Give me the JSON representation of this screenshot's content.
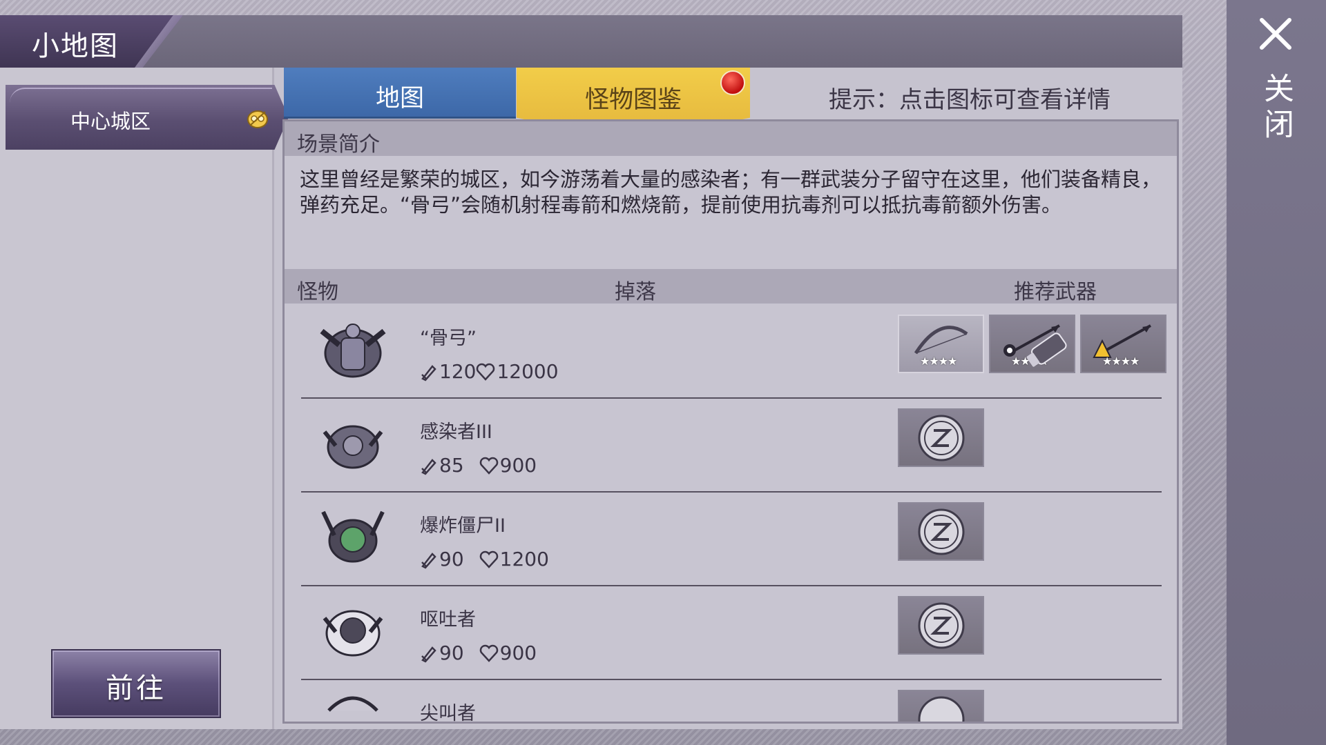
{
  "window": {
    "title": "小地图"
  },
  "sidebar": {
    "items": [
      {
        "label": "中心城区"
      }
    ],
    "go_label": "前往"
  },
  "tabs": {
    "map": "地图",
    "monsters": "怪物图鉴"
  },
  "hint": "提示：点击图标可查看详情",
  "scene": {
    "header": "场景简介",
    "description": "这里曾经是繁荣的城区，如今游荡着大量的感染者；有一群武装分子留守在这里，他们装备精良，弹药充足。“骨弓”会随机射程毒箭和燃烧箭，提前使用抗毒剂可以抵抗毒箭额外伤害。"
  },
  "table": {
    "col_monster": "怪物",
    "col_drop": "掉落",
    "col_weapon": "推荐武器",
    "rows": [
      {
        "name": "“骨弓”",
        "atk": "120",
        "hp": "12000",
        "drops": [
          "bow-icon",
          "poison-arrow-icon",
          "fire-arrow-icon"
        ],
        "drop_stars": "★★★★",
        "weapon": "vial-icon"
      },
      {
        "name": "感染者III",
        "atk": "85",
        "hp": "900",
        "drops": [
          "coin-icon"
        ]
      },
      {
        "name": "爆炸僵尸II",
        "atk": "90",
        "hp": "1200",
        "drops": [
          "coin-icon"
        ]
      },
      {
        "name": "呕吐者",
        "atk": "90",
        "hp": "900",
        "drops": [
          "coin-icon"
        ]
      },
      {
        "name": "尖叫者",
        "drops": [
          "coin-icon"
        ]
      }
    ]
  },
  "close_label": "关闭",
  "colors": {
    "tab_blue": "#3c67a7",
    "tab_gold": "#e2b33a",
    "panel": "#c8c5d1",
    "sidebar_purple": "#5b4f72"
  }
}
